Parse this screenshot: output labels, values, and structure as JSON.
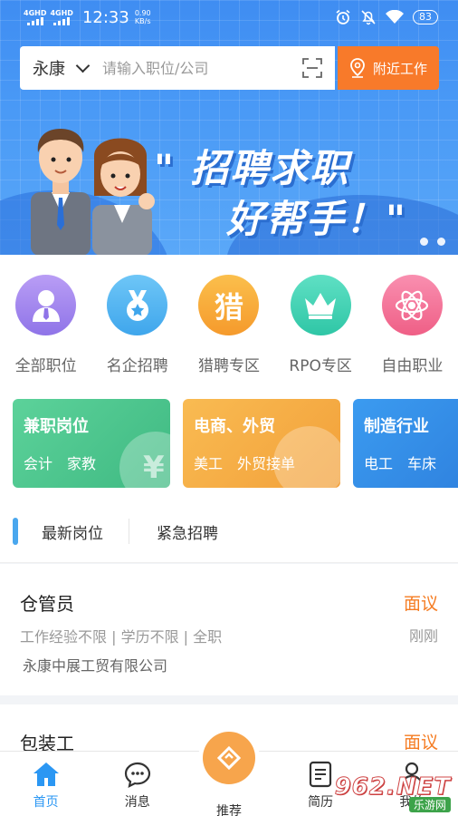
{
  "status_bar": {
    "network_1": "4GHD",
    "network_2": "4GHD",
    "time": "12:33",
    "speed_value": "0.90",
    "speed_unit": "KB/s",
    "battery": "83"
  },
  "search": {
    "city": "永康",
    "placeholder": "请输入职位/公司",
    "nearby_label": "附近工作"
  },
  "banner": {
    "slogan_line1": "\" 招聘求职",
    "slogan_line2": "好帮手！\""
  },
  "categories": [
    {
      "label": "全部职位",
      "icon": "person-icon",
      "color": "#a98ef0"
    },
    {
      "label": "名企招聘",
      "icon": "medal-icon",
      "color": "#52b6f2"
    },
    {
      "label": "猎聘专区",
      "icon": "hunt-icon",
      "glyph": "猎",
      "color": "#f9a93a"
    },
    {
      "label": "RPO专区",
      "icon": "crown-icon",
      "color": "#3fd2b4"
    },
    {
      "label": "自由职业",
      "icon": "atom-icon",
      "color": "#f4769a"
    }
  ],
  "industry_cards": [
    {
      "title": "兼职岗位",
      "tags": [
        "会计",
        "家教"
      ],
      "color": "#4fc78f"
    },
    {
      "title": "电商、外贸",
      "tags": [
        "美工",
        "外贸接单"
      ],
      "color": "#f6a83c"
    },
    {
      "title": "制造行业",
      "tags": [
        "电工",
        "车床"
      ],
      "color": "#2f8de8"
    }
  ],
  "tabs": [
    {
      "label": "最新岗位"
    },
    {
      "label": "紧急招聘"
    }
  ],
  "jobs": [
    {
      "title": "仓管员",
      "salary": "面议",
      "meta": "工作经验不限 | 学历不限 | 全职",
      "time": "刚刚",
      "company": "永康中展工贸有限公司"
    },
    {
      "title": "包装工",
      "salary": "面议"
    }
  ],
  "bottom_nav": [
    {
      "label": "首页",
      "icon": "home-icon"
    },
    {
      "label": "消息",
      "icon": "message-icon"
    },
    {
      "label": "推荐",
      "icon": "recommend-icon"
    },
    {
      "label": "简历",
      "icon": "resume-icon"
    },
    {
      "label": "我的",
      "icon": "profile-icon"
    }
  ],
  "watermark": {
    "number": "962.NET",
    "sub": "乐游网"
  },
  "colors": {
    "primary_blue": "#3f8df2",
    "accent_orange": "#f87a2a",
    "salary_orange": "#f57c22",
    "nav_active": "#2b97f3"
  }
}
